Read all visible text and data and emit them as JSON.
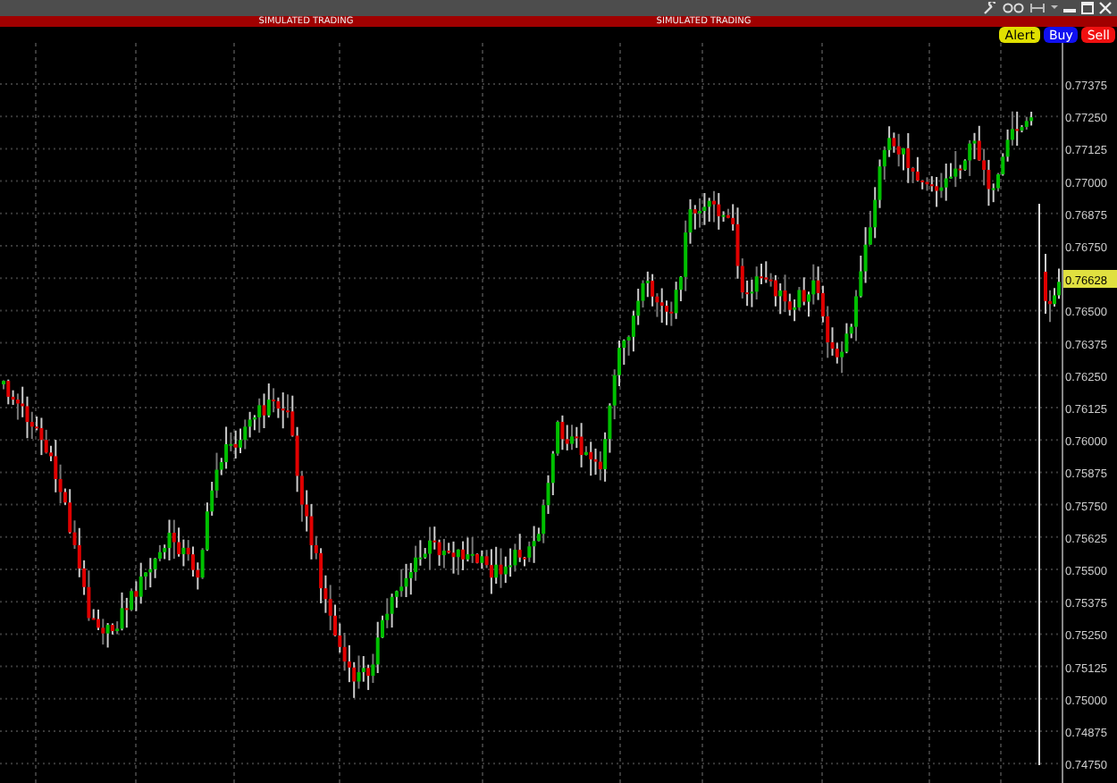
{
  "banner": [
    "SIMULATED TRADING",
    "SIMULATED TRADING"
  ],
  "order_buttons": [
    {
      "label": "Alert",
      "kind": "alert"
    },
    {
      "label": "Buy",
      "kind": "buy"
    },
    {
      "label": "Sell",
      "kind": "sell"
    }
  ],
  "price_axis": {
    "labels": [
      "0.77375",
      "0.77250",
      "0.77125",
      "0.77000",
      "0.76875",
      "0.76750",
      "0.76500",
      "0.76375",
      "0.76250",
      "0.76125",
      "0.76000",
      "0.75875",
      "0.75750",
      "0.75625",
      "0.75500",
      "0.75375",
      "0.75250",
      "0.75125",
      "0.75000",
      "0.74875",
      "0.74750"
    ],
    "price_tag": "0.76628"
  }
}
